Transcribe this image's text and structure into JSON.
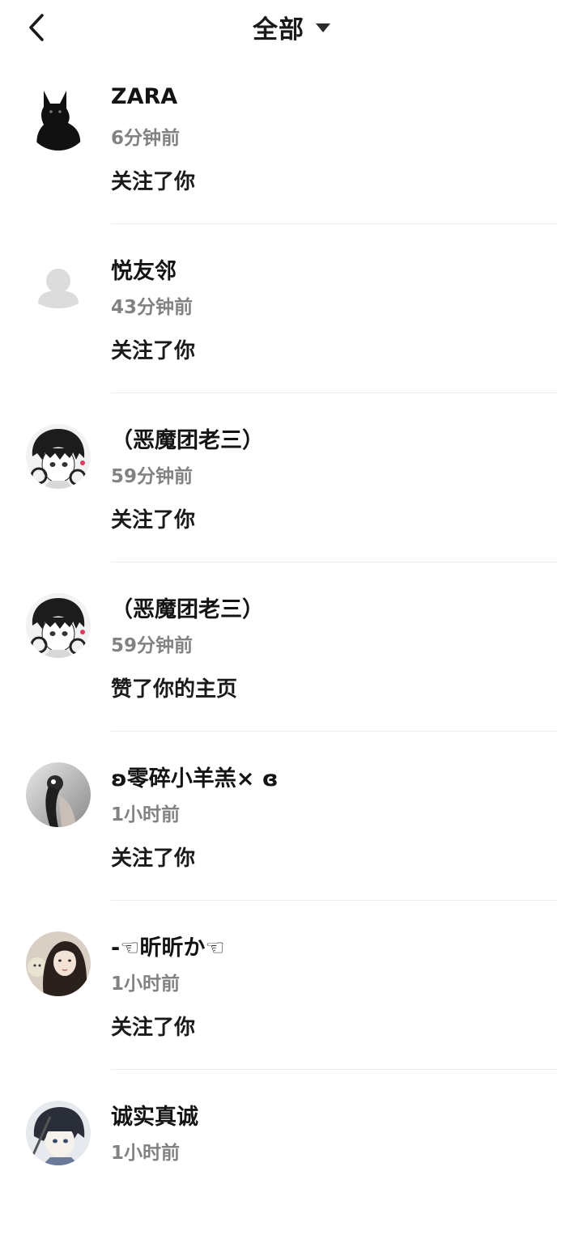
{
  "header": {
    "title": "全部",
    "back_icon": "chevron-left-icon",
    "dropdown_icon": "caret-down-icon"
  },
  "colors": {
    "name": "#141414",
    "time": "#828282",
    "divider": "#ececec"
  },
  "notifications": [
    {
      "name": "ZARA",
      "time": "6分钟前",
      "action": "关注了你",
      "avatar": "black-cat-avatar"
    },
    {
      "name": "悦友邻",
      "time": "43分钟前",
      "action": "关注了你",
      "avatar": "default-avatar"
    },
    {
      "name": "（恶魔团老三）",
      "time": "59分钟前",
      "action": "关注了你",
      "avatar": "anime-boy-avatar"
    },
    {
      "name": "（恶魔团老三）",
      "time": "59分钟前",
      "action": "赞了你的主页",
      "avatar": "anime-boy-avatar"
    },
    {
      "name": "ʚ零碎小羊羔× ɞ",
      "time": "1小时前",
      "action": "关注了你",
      "avatar": "photo-avatar-dark"
    },
    {
      "name": "-☜昕昕か☜",
      "time": "1小时前",
      "action": "关注了你",
      "avatar": "photo-avatar-girl"
    },
    {
      "name": "诚实真诚",
      "time": "1小时前",
      "action": "",
      "avatar": "anime-swordsman-avatar"
    }
  ]
}
